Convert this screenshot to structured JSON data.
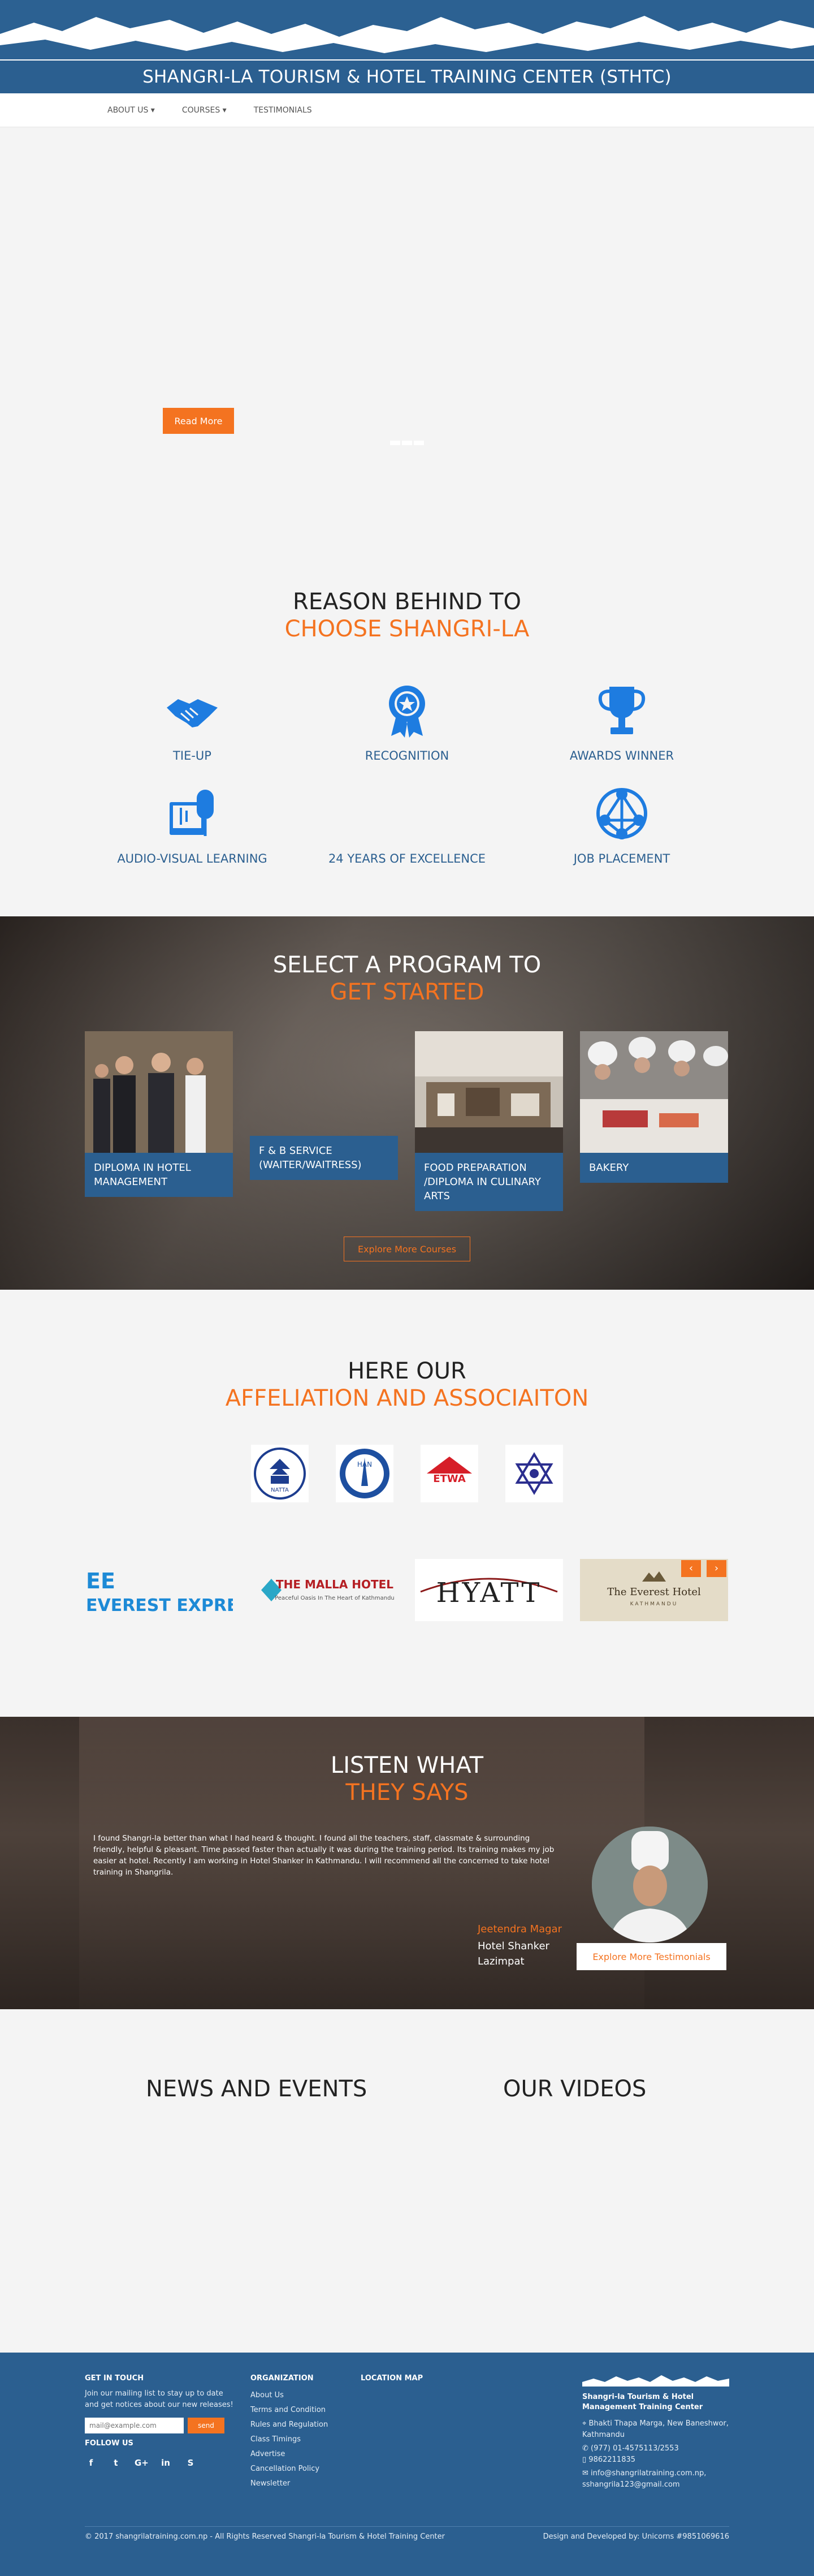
{
  "header": {
    "title": "SHANGRI-LA TOURISM & HOTEL TRAINING CENTER (STHTC)",
    "nav": [
      "ABOUT US",
      "COURSES",
      "TESTIMONIALS"
    ],
    "caret": "▾"
  },
  "hero": {
    "button": "Read More"
  },
  "reasons": {
    "heading_1": "REASON BEHIND TO",
    "heading_2": "CHOOSE SHANGRI-LA",
    "items": [
      "TIE-UP",
      "RECOGNITION",
      "AWARDS WINNER",
      "AUDIO-VISUAL LEARNING",
      "24 YEARS OF EXCELLENCE",
      "JOB PLACEMENT"
    ],
    "icons": [
      "handshake-icon",
      "ribbon-icon",
      "trophy-icon",
      "audio-visual-icon",
      "",
      "network-icon"
    ]
  },
  "programs": {
    "heading_1": "SELECT A PROGRAM TO",
    "heading_2": "GET STARTED",
    "items": [
      "DIPLOMA IN HOTEL MANAGEMENT",
      "F & B SERVICE (WAITER/WAITRESS)",
      "FOOD PREPARATION /DIPLOMA IN CULINARY ARTS",
      "BAKERY"
    ],
    "button": "Explore More Courses"
  },
  "affiliation": {
    "heading_1": "HERE OUR",
    "heading_2": "AFFELIATION AND ASSOCIAITON",
    "associations": [
      "NATTA",
      "HAN",
      "ETWA",
      "NATHM"
    ],
    "prev": "‹",
    "next": "›",
    "partners": {
      "everest_express": "EVEREST EXPRESS",
      "malla": "THE MALLA HOTEL",
      "malla_tagline": "Peaceful Oasis In The Heart of Kathmandu",
      "hyatt": "HYATT",
      "everest_hotel": "The Everest Hotel",
      "everest_hotel_city": "KATHMANDU"
    }
  },
  "testimonials": {
    "heading_1": "LISTEN WHAT",
    "heading_2": "THEY SAYS",
    "quote": "I found Shangri-la better than what I had heard & thought. I found all the teachers, staff, classmate & surrounding friendly, helpful & pleasant. Time passed faster than actually it was during the training period. Its training makes my job easier at hotel. Recently I am working in Hotel Shanker in Kathmandu. I will recommend all the concerned to take hotel training in Shangrila.",
    "name": "Jeetendra Magar",
    "org_1": "Hotel Shanker",
    "org_2": "Lazimpat",
    "button": "Explore More Testimonials"
  },
  "news": {
    "news_title": "NEWS AND EVENTS",
    "videos_title": "OUR VIDEOS"
  },
  "footer": {
    "get_in_touch": "GET IN TOUCH",
    "newsletter_text": "Join our mailing list to stay up to date and get notices about our new releases!",
    "email_placeholder": "mail@example.com",
    "send": "send",
    "follow_us": "FOLLOW US",
    "social": [
      "f",
      "t",
      "G+",
      "in",
      "S"
    ],
    "organization": "ORGANIZATION",
    "links": [
      "About Us",
      "Terms and Condition",
      "Rules and Regulation",
      "Class Timings",
      "Advertise",
      "Cancellation Policy",
      "Newsletter"
    ],
    "location_map": "LOCATION MAP",
    "org_name": "Shangri-la Tourism & Hotel Management Training Center",
    "address": "Bhakti Thapa Marga, New Baneshwor, Kathmandu",
    "phone_1": "(977) 01-4575113/2553",
    "phone_2": "9862211835",
    "email": "info@shangrilatraining.com.np, sshangrila123@gmail.com",
    "copyright": "© 2017 shangrilatraining.com.np - All Rights Reserved Shangri-la Tourism & Hotel Training Center",
    "credit": "Design and Developed by: Unicorns #9851069616"
  }
}
